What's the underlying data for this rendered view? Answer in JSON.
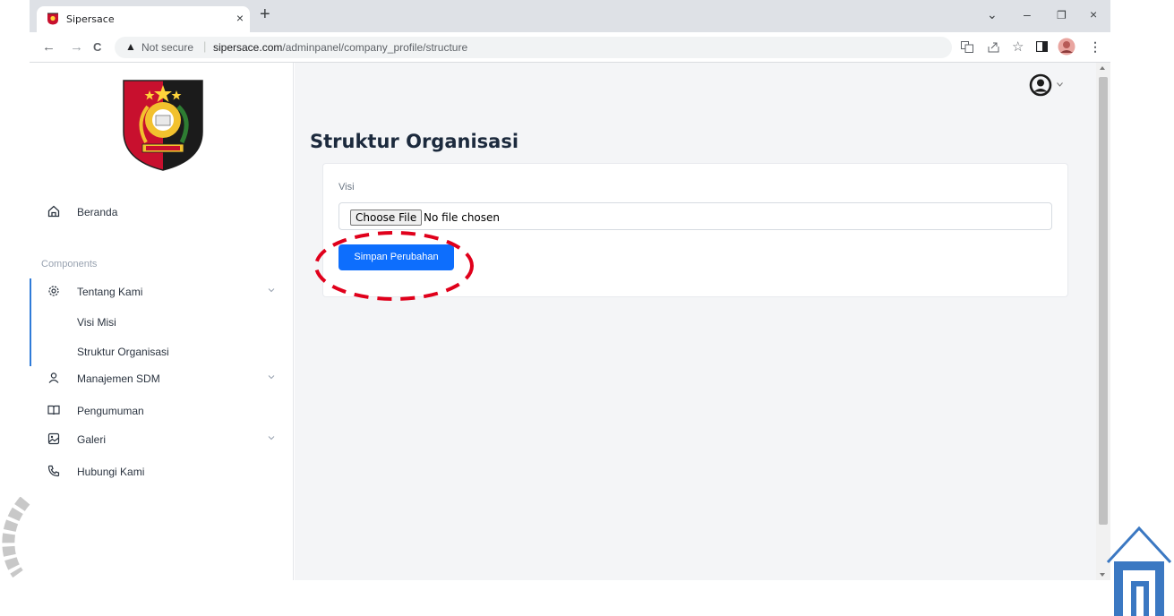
{
  "browser": {
    "tab_title": "Sipersace",
    "tab_close": "×",
    "new_tab": "+",
    "window_controls": [
      "⌄",
      "–",
      "❐",
      "×"
    ],
    "nav": {
      "back": "←",
      "forward": "→",
      "reload": "C"
    },
    "security_warning": "Not secure",
    "url_host": "sipersace.com",
    "url_path": "/adminpanel/company_profile/structure",
    "toolbar_icons": [
      "translate-icon",
      "share-icon",
      "star-icon",
      "sidepanel-icon",
      "profile-avatar-icon",
      "more-icon"
    ]
  },
  "sidebar": {
    "logo": "logo-emblem",
    "items_top": [
      {
        "label": "Beranda",
        "icon": "home-icon"
      }
    ],
    "section_label": "Components",
    "items": [
      {
        "label": "Tentang Kami",
        "icon": "gear-icon",
        "expandable": true
      },
      {
        "label": "Manajemen SDM",
        "icon": "user-icon",
        "expandable": true
      },
      {
        "label": "Pengumuman",
        "icon": "book-icon",
        "expandable": false
      },
      {
        "label": "Galeri",
        "icon": "image-icon",
        "expandable": true
      },
      {
        "label": "Hubungi Kami",
        "icon": "phone-icon",
        "expandable": false
      }
    ],
    "sub_items": [
      {
        "label": "Visi Misi"
      },
      {
        "label": "Struktur Organisasi"
      }
    ]
  },
  "main": {
    "title": "Struktur Organisasi",
    "form": {
      "field_label": "Visi",
      "file_button": "Choose File",
      "file_status": "No file chosen",
      "submit_label": "Simpan Perubahan"
    }
  },
  "colors": {
    "primary": "#0d6efd",
    "annotation": "#e0001b",
    "active_bar": "#2f7bd8",
    "title": "#1c2a3d"
  }
}
